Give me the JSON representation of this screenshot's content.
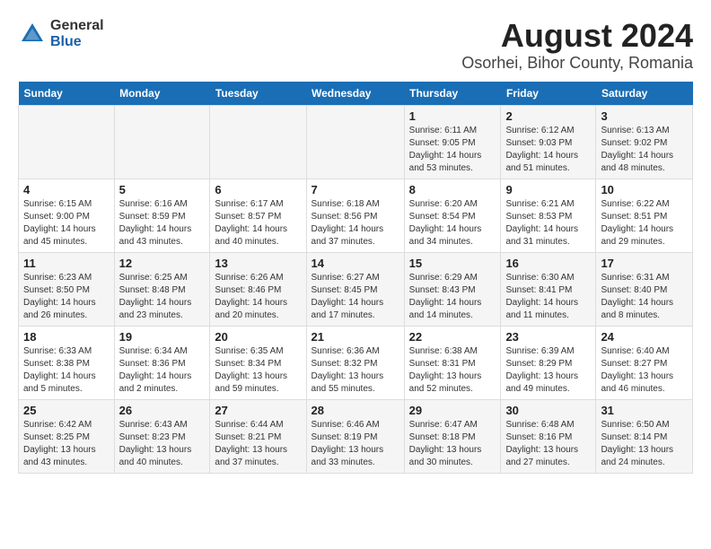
{
  "logo": {
    "general": "General",
    "blue": "Blue"
  },
  "title": "August 2024",
  "subtitle": "Osorhei, Bihor County, Romania",
  "weekdays": [
    "Sunday",
    "Monday",
    "Tuesday",
    "Wednesday",
    "Thursday",
    "Friday",
    "Saturday"
  ],
  "weeks": [
    [
      {
        "day": "",
        "detail": ""
      },
      {
        "day": "",
        "detail": ""
      },
      {
        "day": "",
        "detail": ""
      },
      {
        "day": "",
        "detail": ""
      },
      {
        "day": "1",
        "detail": "Sunrise: 6:11 AM\nSunset: 9:05 PM\nDaylight: 14 hours\nand 53 minutes."
      },
      {
        "day": "2",
        "detail": "Sunrise: 6:12 AM\nSunset: 9:03 PM\nDaylight: 14 hours\nand 51 minutes."
      },
      {
        "day": "3",
        "detail": "Sunrise: 6:13 AM\nSunset: 9:02 PM\nDaylight: 14 hours\nand 48 minutes."
      }
    ],
    [
      {
        "day": "4",
        "detail": "Sunrise: 6:15 AM\nSunset: 9:00 PM\nDaylight: 14 hours\nand 45 minutes."
      },
      {
        "day": "5",
        "detail": "Sunrise: 6:16 AM\nSunset: 8:59 PM\nDaylight: 14 hours\nand 43 minutes."
      },
      {
        "day": "6",
        "detail": "Sunrise: 6:17 AM\nSunset: 8:57 PM\nDaylight: 14 hours\nand 40 minutes."
      },
      {
        "day": "7",
        "detail": "Sunrise: 6:18 AM\nSunset: 8:56 PM\nDaylight: 14 hours\nand 37 minutes."
      },
      {
        "day": "8",
        "detail": "Sunrise: 6:20 AM\nSunset: 8:54 PM\nDaylight: 14 hours\nand 34 minutes."
      },
      {
        "day": "9",
        "detail": "Sunrise: 6:21 AM\nSunset: 8:53 PM\nDaylight: 14 hours\nand 31 minutes."
      },
      {
        "day": "10",
        "detail": "Sunrise: 6:22 AM\nSunset: 8:51 PM\nDaylight: 14 hours\nand 29 minutes."
      }
    ],
    [
      {
        "day": "11",
        "detail": "Sunrise: 6:23 AM\nSunset: 8:50 PM\nDaylight: 14 hours\nand 26 minutes."
      },
      {
        "day": "12",
        "detail": "Sunrise: 6:25 AM\nSunset: 8:48 PM\nDaylight: 14 hours\nand 23 minutes."
      },
      {
        "day": "13",
        "detail": "Sunrise: 6:26 AM\nSunset: 8:46 PM\nDaylight: 14 hours\nand 20 minutes."
      },
      {
        "day": "14",
        "detail": "Sunrise: 6:27 AM\nSunset: 8:45 PM\nDaylight: 14 hours\nand 17 minutes."
      },
      {
        "day": "15",
        "detail": "Sunrise: 6:29 AM\nSunset: 8:43 PM\nDaylight: 14 hours\nand 14 minutes."
      },
      {
        "day": "16",
        "detail": "Sunrise: 6:30 AM\nSunset: 8:41 PM\nDaylight: 14 hours\nand 11 minutes."
      },
      {
        "day": "17",
        "detail": "Sunrise: 6:31 AM\nSunset: 8:40 PM\nDaylight: 14 hours\nand 8 minutes."
      }
    ],
    [
      {
        "day": "18",
        "detail": "Sunrise: 6:33 AM\nSunset: 8:38 PM\nDaylight: 14 hours\nand 5 minutes."
      },
      {
        "day": "19",
        "detail": "Sunrise: 6:34 AM\nSunset: 8:36 PM\nDaylight: 14 hours\nand 2 minutes."
      },
      {
        "day": "20",
        "detail": "Sunrise: 6:35 AM\nSunset: 8:34 PM\nDaylight: 13 hours\nand 59 minutes."
      },
      {
        "day": "21",
        "detail": "Sunrise: 6:36 AM\nSunset: 8:32 PM\nDaylight: 13 hours\nand 55 minutes."
      },
      {
        "day": "22",
        "detail": "Sunrise: 6:38 AM\nSunset: 8:31 PM\nDaylight: 13 hours\nand 52 minutes."
      },
      {
        "day": "23",
        "detail": "Sunrise: 6:39 AM\nSunset: 8:29 PM\nDaylight: 13 hours\nand 49 minutes."
      },
      {
        "day": "24",
        "detail": "Sunrise: 6:40 AM\nSunset: 8:27 PM\nDaylight: 13 hours\nand 46 minutes."
      }
    ],
    [
      {
        "day": "25",
        "detail": "Sunrise: 6:42 AM\nSunset: 8:25 PM\nDaylight: 13 hours\nand 43 minutes."
      },
      {
        "day": "26",
        "detail": "Sunrise: 6:43 AM\nSunset: 8:23 PM\nDaylight: 13 hours\nand 40 minutes."
      },
      {
        "day": "27",
        "detail": "Sunrise: 6:44 AM\nSunset: 8:21 PM\nDaylight: 13 hours\nand 37 minutes."
      },
      {
        "day": "28",
        "detail": "Sunrise: 6:46 AM\nSunset: 8:19 PM\nDaylight: 13 hours\nand 33 minutes."
      },
      {
        "day": "29",
        "detail": "Sunrise: 6:47 AM\nSunset: 8:18 PM\nDaylight: 13 hours\nand 30 minutes."
      },
      {
        "day": "30",
        "detail": "Sunrise: 6:48 AM\nSunset: 8:16 PM\nDaylight: 13 hours\nand 27 minutes."
      },
      {
        "day": "31",
        "detail": "Sunrise: 6:50 AM\nSunset: 8:14 PM\nDaylight: 13 hours\nand 24 minutes."
      }
    ]
  ]
}
